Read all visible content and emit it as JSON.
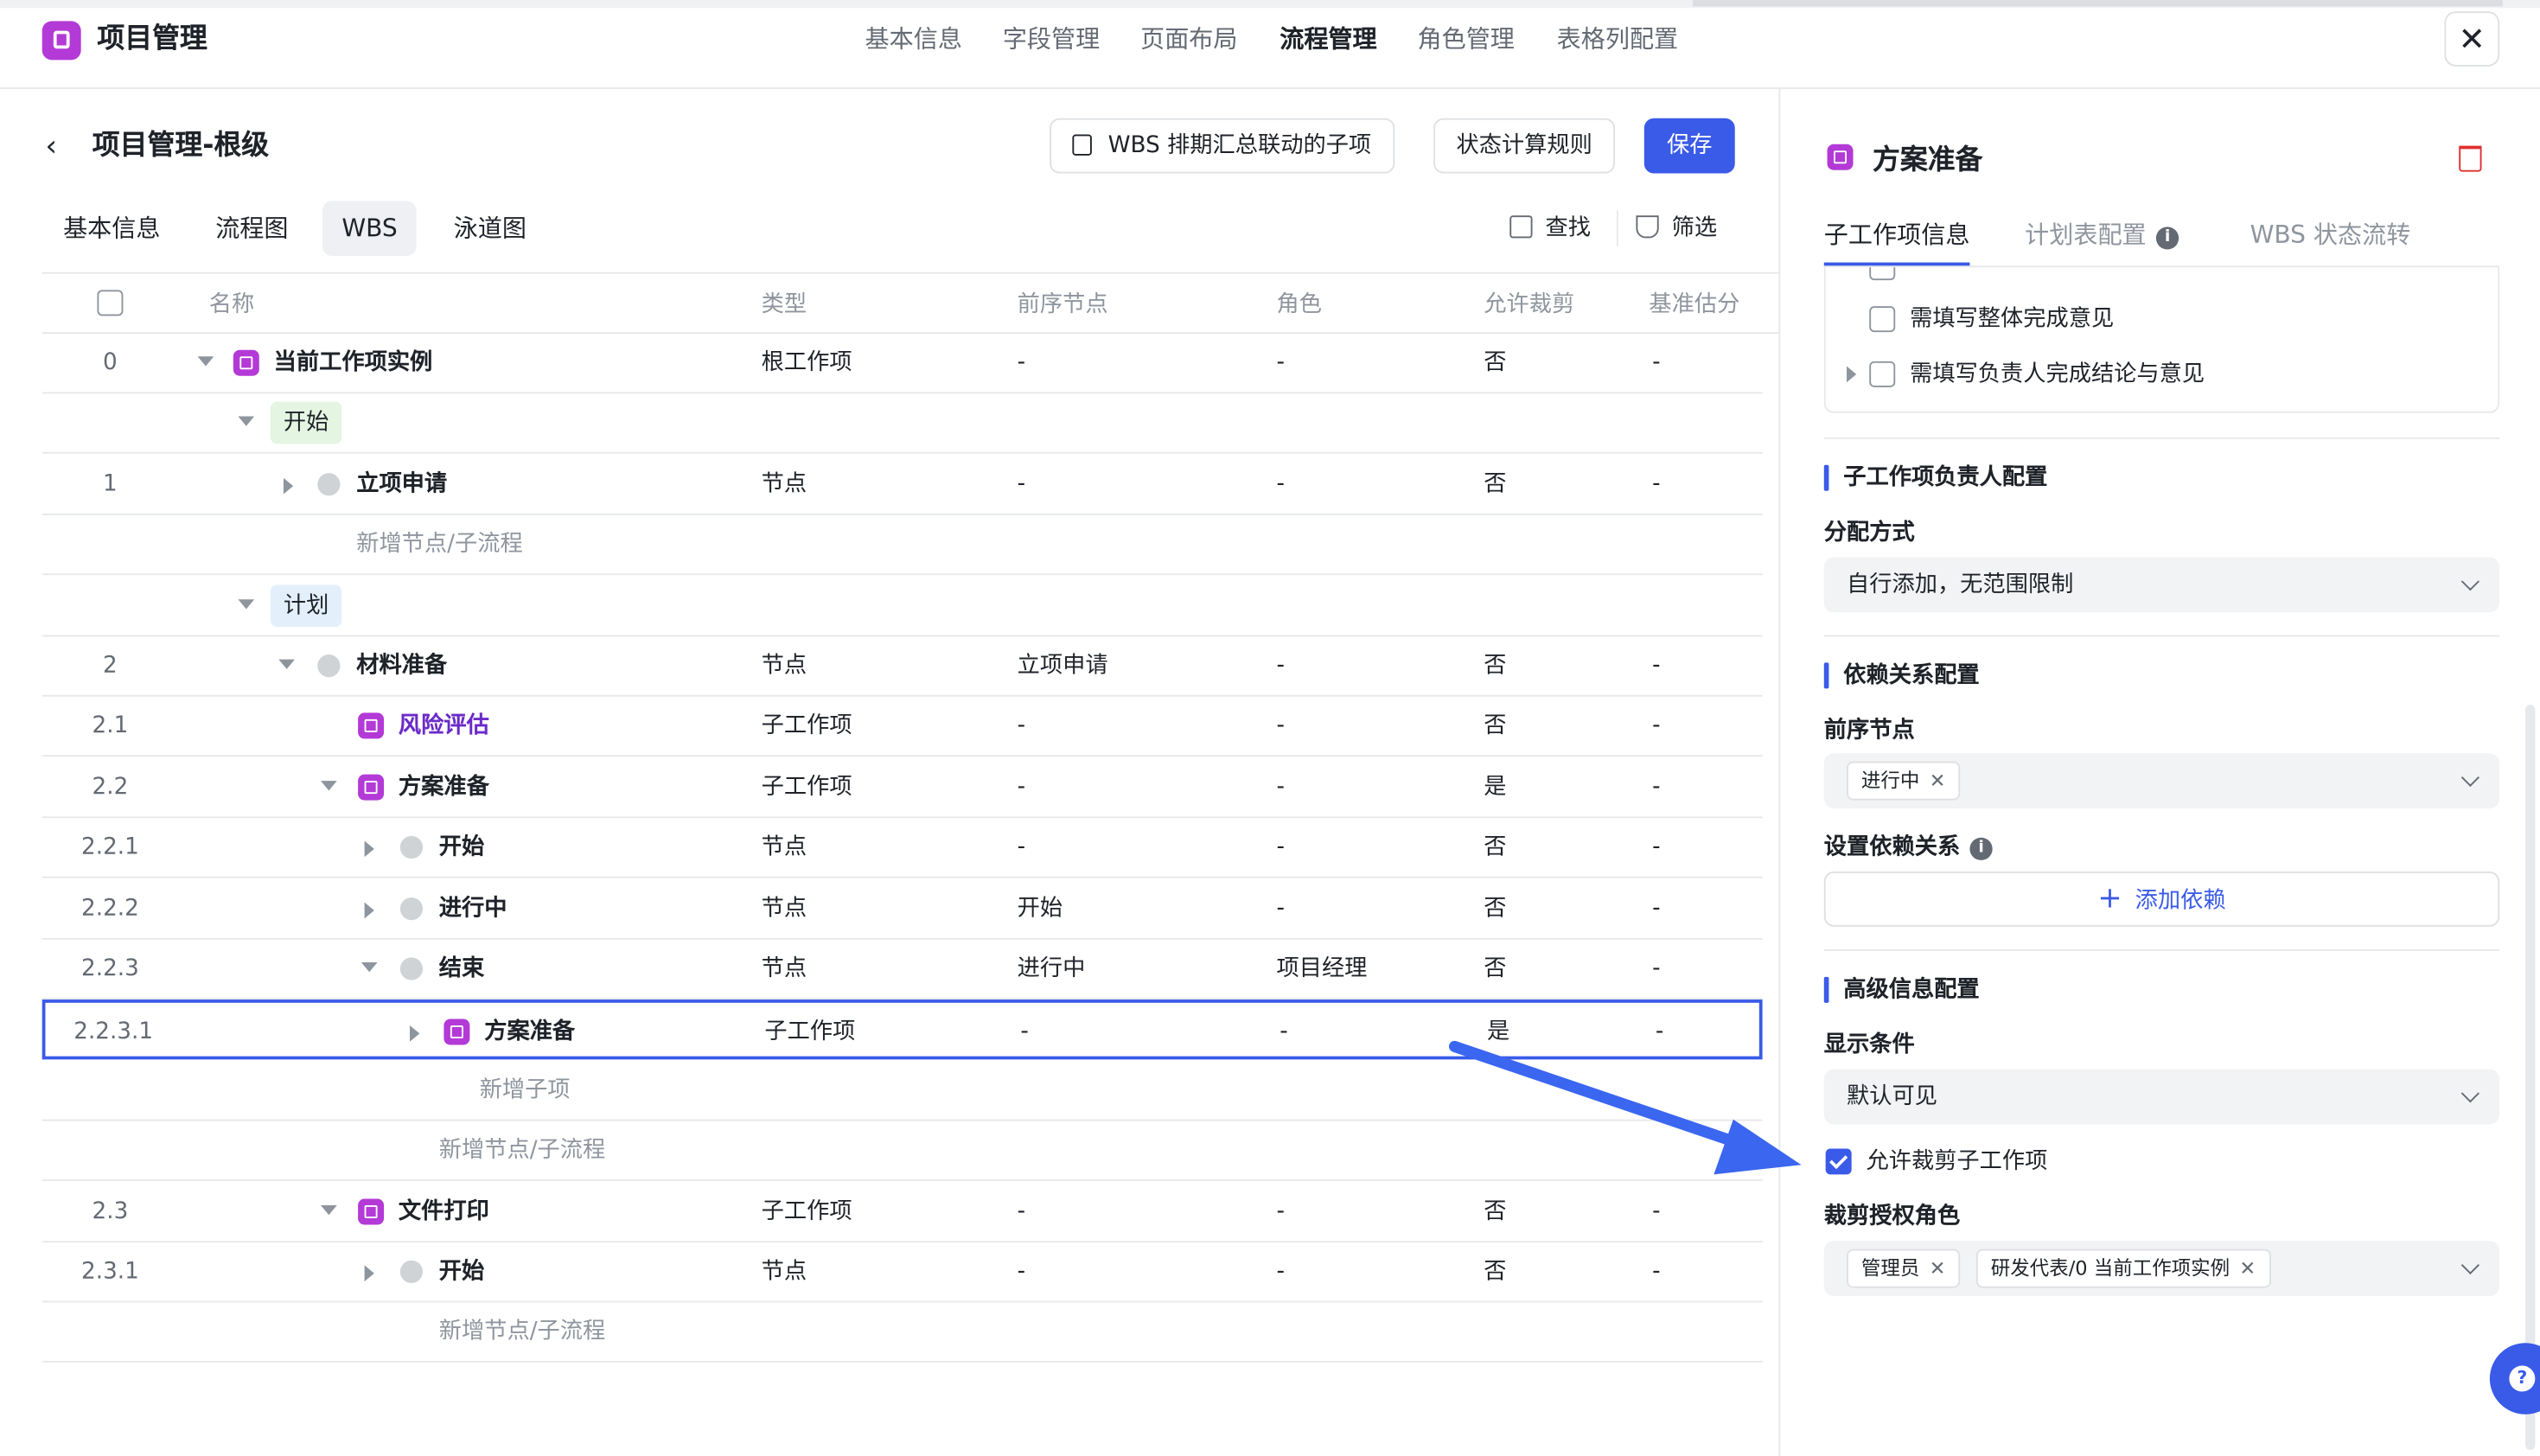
{
  "app": {
    "title": "项目管理",
    "nav": [
      "基本信息",
      "字段管理",
      "页面布局",
      "流程管理",
      "角色管理",
      "表格列配置"
    ],
    "active_nav": "流程管理"
  },
  "page": {
    "title": "项目管理-根级",
    "buttons": {
      "wbs_linked": "WBS 排期汇总联动的子项",
      "status_rule": "状态计算规则",
      "save": "保存"
    },
    "subtabs": [
      "基本信息",
      "流程图",
      "WBS",
      "泳道图"
    ],
    "tools": {
      "find": "查找",
      "filter": "筛选"
    }
  },
  "table": {
    "headers": [
      "名称",
      "类型",
      "前序节点",
      "角色",
      "允许裁剪",
      "基准估分"
    ],
    "rows": [
      {
        "num": "0",
        "name": "当前工作项实例",
        "type": "根工作项",
        "pre": "-",
        "role": "-",
        "cut": "否",
        "score": "-"
      },
      {
        "group": "开始"
      },
      {
        "num": "1",
        "name": "立项申请",
        "type": "节点",
        "pre": "-",
        "role": "-",
        "cut": "否",
        "score": "-"
      },
      {
        "add": "新增节点/子流程"
      },
      {
        "group": "计划"
      },
      {
        "num": "2",
        "name": "材料准备",
        "type": "节点",
        "pre": "立项申请",
        "role": "-",
        "cut": "否",
        "score": "-"
      },
      {
        "num": "2.1",
        "name": "风险评估",
        "type": "子工作项",
        "pre": "-",
        "role": "-",
        "cut": "否",
        "score": "-"
      },
      {
        "num": "2.2",
        "name": "方案准备",
        "type": "子工作项",
        "pre": "-",
        "role": "-",
        "cut": "是",
        "score": "-"
      },
      {
        "num": "2.2.1",
        "name": "开始",
        "type": "节点",
        "pre": "-",
        "role": "-",
        "cut": "否",
        "score": "-"
      },
      {
        "num": "2.2.2",
        "name": "进行中",
        "type": "节点",
        "pre": "开始",
        "role": "-",
        "cut": "否",
        "score": "-"
      },
      {
        "num": "2.2.3",
        "name": "结束",
        "type": "节点",
        "pre": "进行中",
        "role": "项目经理",
        "cut": "否",
        "score": "-"
      },
      {
        "num": "2.2.3.1",
        "name": "方案准备",
        "type": "子工作项",
        "pre": "-",
        "role": "-",
        "cut": "是",
        "score": "-"
      },
      {
        "add": "新增子项"
      },
      {
        "add": "新增节点/子流程"
      },
      {
        "num": "2.3",
        "name": "文件打印",
        "type": "子工作项",
        "pre": "-",
        "role": "-",
        "cut": "否",
        "score": "-"
      },
      {
        "num": "2.3.1",
        "name": "开始",
        "type": "节点",
        "pre": "-",
        "role": "-",
        "cut": "否",
        "score": "-"
      },
      {
        "add": "新增节点/子流程"
      }
    ]
  },
  "panel": {
    "title": "方案准备",
    "tabs": [
      "子工作项信息",
      "计划表配置",
      "WBS 状态流转"
    ],
    "list": [
      "需填写整体完成意见",
      "需填写负责人完成结论与意见"
    ],
    "owner": {
      "section": "子工作项负责人配置",
      "label": "分配方式",
      "value": "自行添加，无范围限制"
    },
    "dep": {
      "section": "依赖关系配置",
      "pre_label": "前序节点",
      "pre_chip": "进行中",
      "set_label": "设置依赖关系",
      "add": "添加依赖"
    },
    "adv": {
      "section": "高级信息配置",
      "cond_label": "显示条件",
      "cond_value": "默认可见",
      "allow_cut": "允许裁剪子工作项",
      "role_label": "裁剪授权角色",
      "chips": [
        "管理员",
        "研发代表/0 当前工作项实例"
      ]
    }
  },
  "colors": {
    "accent": "#3a5ae8",
    "workitem": "#b33ad6",
    "danger": "#e02e2e"
  }
}
